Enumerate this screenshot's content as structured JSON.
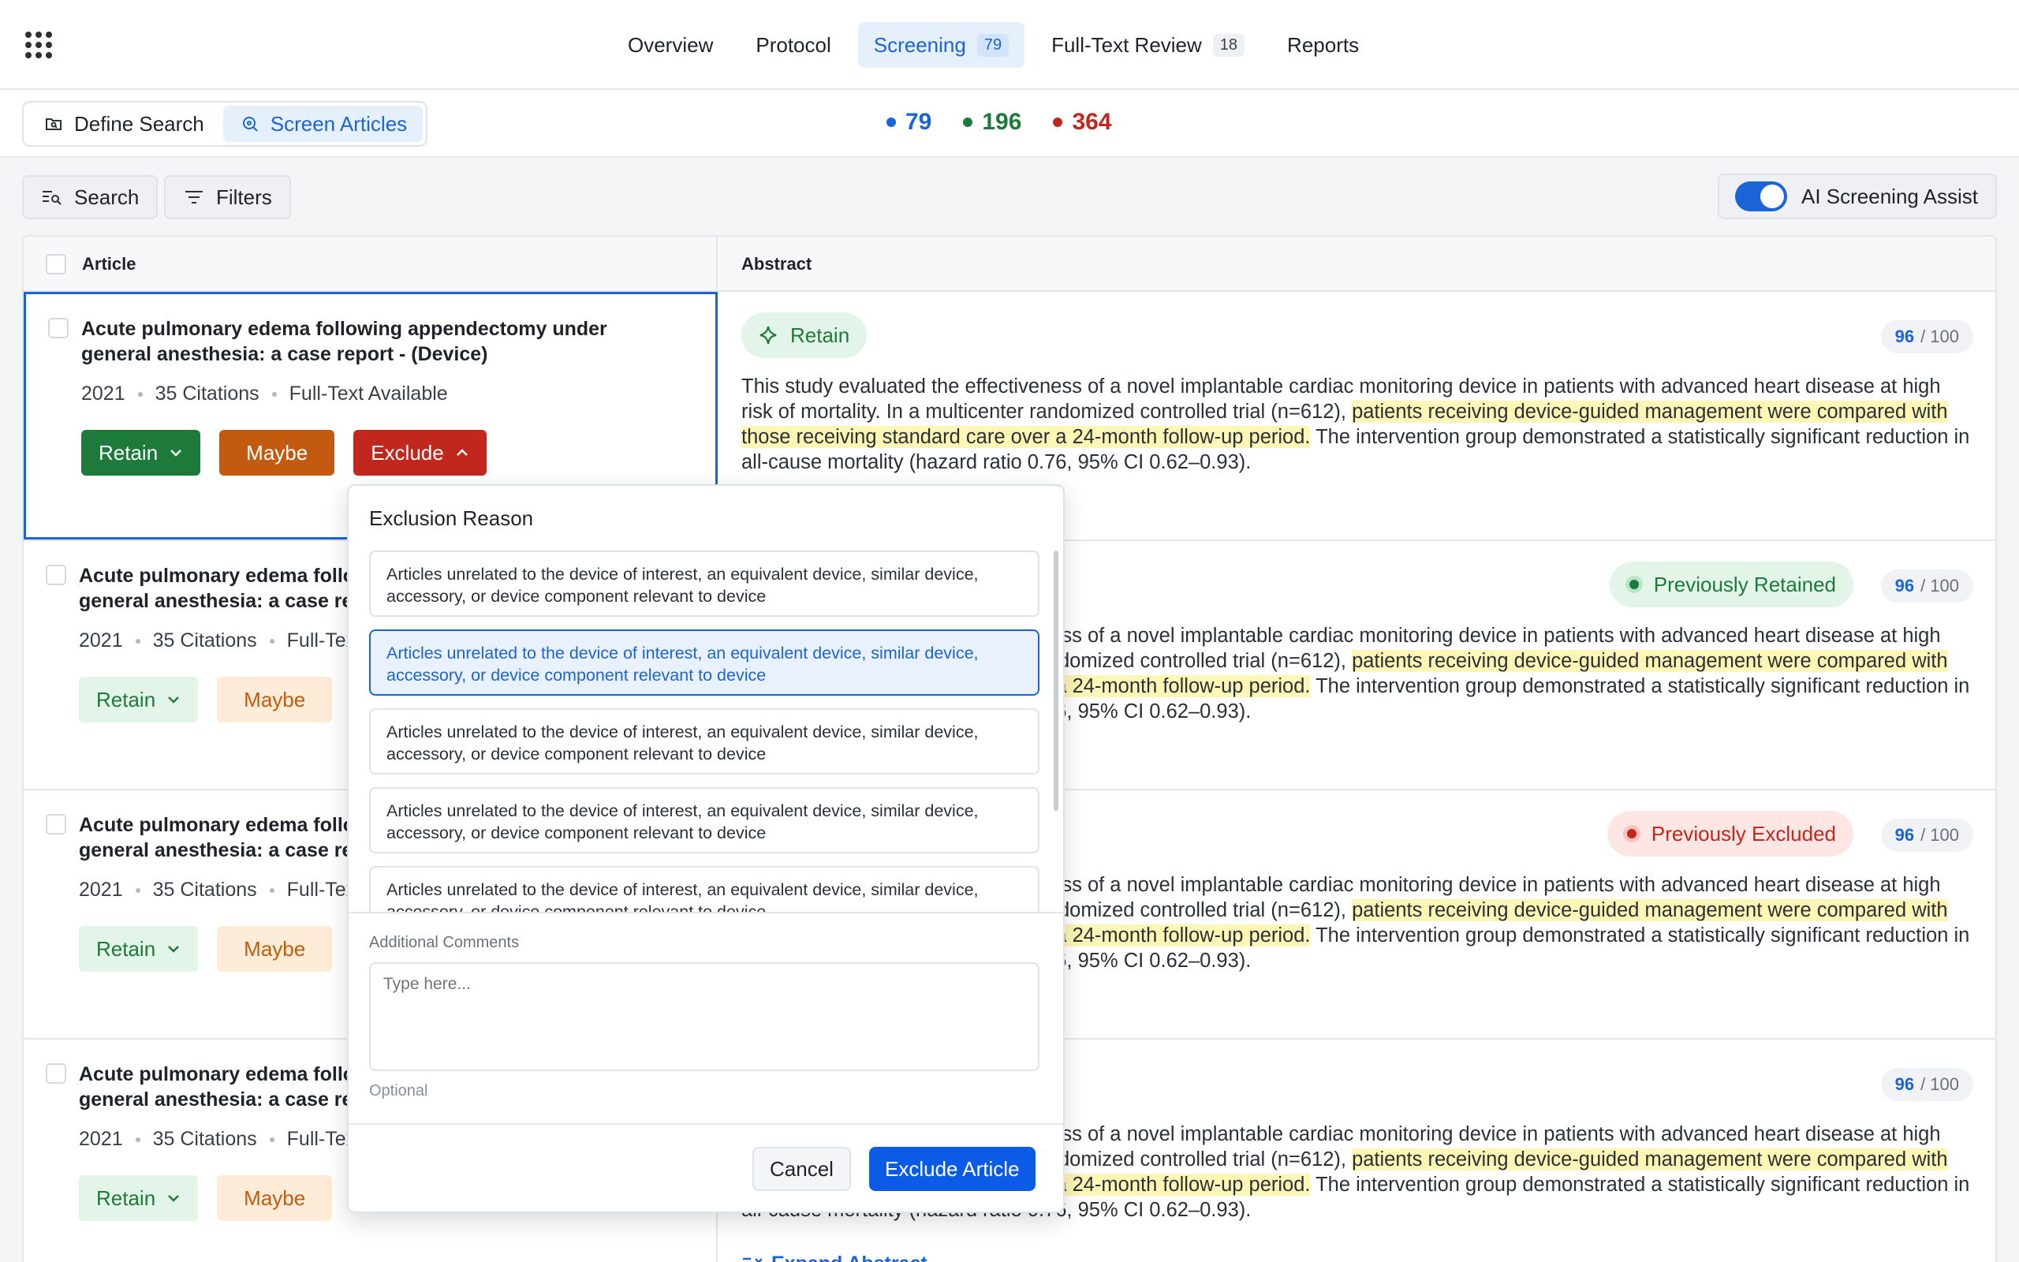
{
  "nav": {
    "tabs": [
      {
        "label": "Overview",
        "badge": ""
      },
      {
        "label": "Protocol",
        "badge": ""
      },
      {
        "label": "Screening",
        "badge": "79"
      },
      {
        "label": "Full-Text Review",
        "badge": "18"
      },
      {
        "label": "Reports",
        "badge": ""
      }
    ],
    "active_tab": "Screening"
  },
  "subbar": {
    "define_search": "Define Search",
    "screen_articles": "Screen Articles",
    "counts": [
      {
        "value": "79",
        "color": "#1b64d8"
      },
      {
        "value": "196",
        "color": "#1d7a3a"
      },
      {
        "value": "364",
        "color": "#c2271e"
      }
    ]
  },
  "toolbar": {
    "search": "Search",
    "filters": "Filters",
    "ai_assist": "AI Screening Assist",
    "ai_assist_on": true
  },
  "table": {
    "col_article": "Article",
    "col_abstract": "Abstract",
    "rows": [
      {
        "title": "Acute pulmonary edema following appendectomy under general anesthesia: a case report - (Device)",
        "year": "2021",
        "citations": "35 Citations",
        "availability": "Full-Text Available",
        "retain": "Retain",
        "maybe": "Maybe",
        "exclude": "Exclude",
        "status": "Retain",
        "score": "96",
        "score_total": "/ 100"
      },
      {
        "title": "Acute pulmonary edema following appendectomy under general anesthesia: a case report - (Device)",
        "year": "2021",
        "citations": "35 Citations",
        "availability": "Full-Text Available",
        "retain": "Retain",
        "maybe": "Maybe",
        "status": "Previously Retained",
        "score": "96",
        "score_total": "/ 100"
      },
      {
        "title": "Acute pulmonary edema following appendectomy under general anesthesia: a case report - (Device)",
        "year": "2021",
        "citations": "35 Citations",
        "availability": "Full-Text Available",
        "retain": "Retain",
        "maybe": "Maybe",
        "status": "Previously Excluded",
        "score": "96",
        "score_total": "/ 100"
      },
      {
        "title": "Acute pulmonary edema following appendectomy under general anesthesia: a case report - (Device)",
        "year": "2021",
        "citations": "35 Citations",
        "availability": "Full-Text Available",
        "retain": "Retain",
        "maybe": "Maybe",
        "status": "",
        "score": "96",
        "score_total": "/ 100"
      }
    ],
    "abstract": {
      "pre": "This study evaluated the effectiveness of a novel implantable cardiac monitoring device in patients with advanced heart disease at high risk of mortality. In a multicenter randomized controlled trial (n=612), ",
      "highlight": "patients receiving device-guided management were compared with those receiving standard care over a 24-month follow-up period.",
      "post": " The intervention group demonstrated a statistically significant reduction in all-cause mortality (hazard ratio 0.76, 95% CI 0.62–0.93)."
    },
    "expand_abstract": "Expand Abstract"
  },
  "popover": {
    "title": "Exclusion Reason",
    "reasons": [
      "Articles unrelated to the device of interest, an equivalent device, similar device, accessory, or device component relevant to device",
      "Articles unrelated to the device of interest, an equivalent device, similar device, accessory, or device component relevant to device",
      "Articles unrelated to the device of interest, an equivalent device, similar device, accessory, or device component relevant to device",
      "Articles unrelated to the device of interest, an equivalent device, similar device, accessory, or device component relevant to device",
      "Articles unrelated to the device of interest, an equivalent device, similar device, accessory, or device component relevant to device"
    ],
    "selected_index": 1,
    "comments_label": "Additional Comments",
    "comments_placeholder": "Type here...",
    "optional": "Optional",
    "cancel": "Cancel",
    "exclude_article": "Exclude Article"
  }
}
